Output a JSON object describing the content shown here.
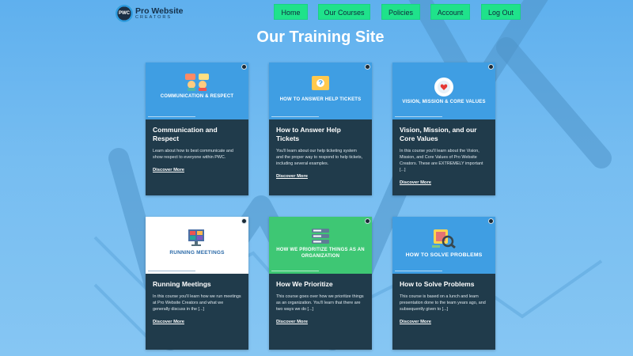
{
  "logo": {
    "mark": "PWC",
    "name": "Pro Website",
    "sub": "CREATORS"
  },
  "nav": [
    {
      "label": "Home"
    },
    {
      "label": "Our Courses"
    },
    {
      "label": "Policies"
    },
    {
      "label": "Account"
    },
    {
      "label": "Log Out"
    }
  ],
  "page_title": "Our Training Site",
  "courses": [
    {
      "thumb_label": "COMMUNICATION & RESPECT",
      "thumb_color": "#3f9ee3",
      "title": "Communication and Respect",
      "desc": "Learn about how to best communicate and show respect to everyone within PWC.",
      "link": "Discover More"
    },
    {
      "thumb_label": "HOW TO ANSWER HELP TICKETS",
      "thumb_color": "#3f9ee3",
      "title": "How to Answer Help Tickets",
      "desc": "You'll learn about our help ticketing system and the proper way to respond to help tickets, including several examples.",
      "link": "Discover More"
    },
    {
      "thumb_label": "VISION, MISSION & CORE VALUES",
      "thumb_color": "#3f9ee3",
      "title": "Vision, Mission, and our Core Values",
      "desc": "In this course you'll learn about the Vision, Mission, and Core Values of Pro Website Creators. These are EXTREMELY important [...]",
      "link": "Discover More"
    },
    {
      "thumb_label": "RUNNING MEETINGS",
      "thumb_color": "#ffffff",
      "title": "Running Meetings",
      "desc": "In this course you'll learn how we run meetings at Pro Website Creators and what we generally discuss in the [...]",
      "link": "Discover More"
    },
    {
      "thumb_label": "HOW WE PRIORITIZE THINGS AS AN ORGANIZATION",
      "thumb_color": "#3ec774",
      "title": "How We Prioritize",
      "desc": "This course goes over how we prioritize things as an organization. You'll learn that there are two ways we do [...]",
      "link": "Discover More"
    },
    {
      "thumb_label": "HOW TO SOLVE PROBLEMS",
      "thumb_color": "#3f9ee3",
      "title": "How to Solve Problems",
      "desc": "This course is based on a lunch and learn presentation done to the team years ago, and subsequently given to [...]",
      "link": "Discover More"
    }
  ]
}
